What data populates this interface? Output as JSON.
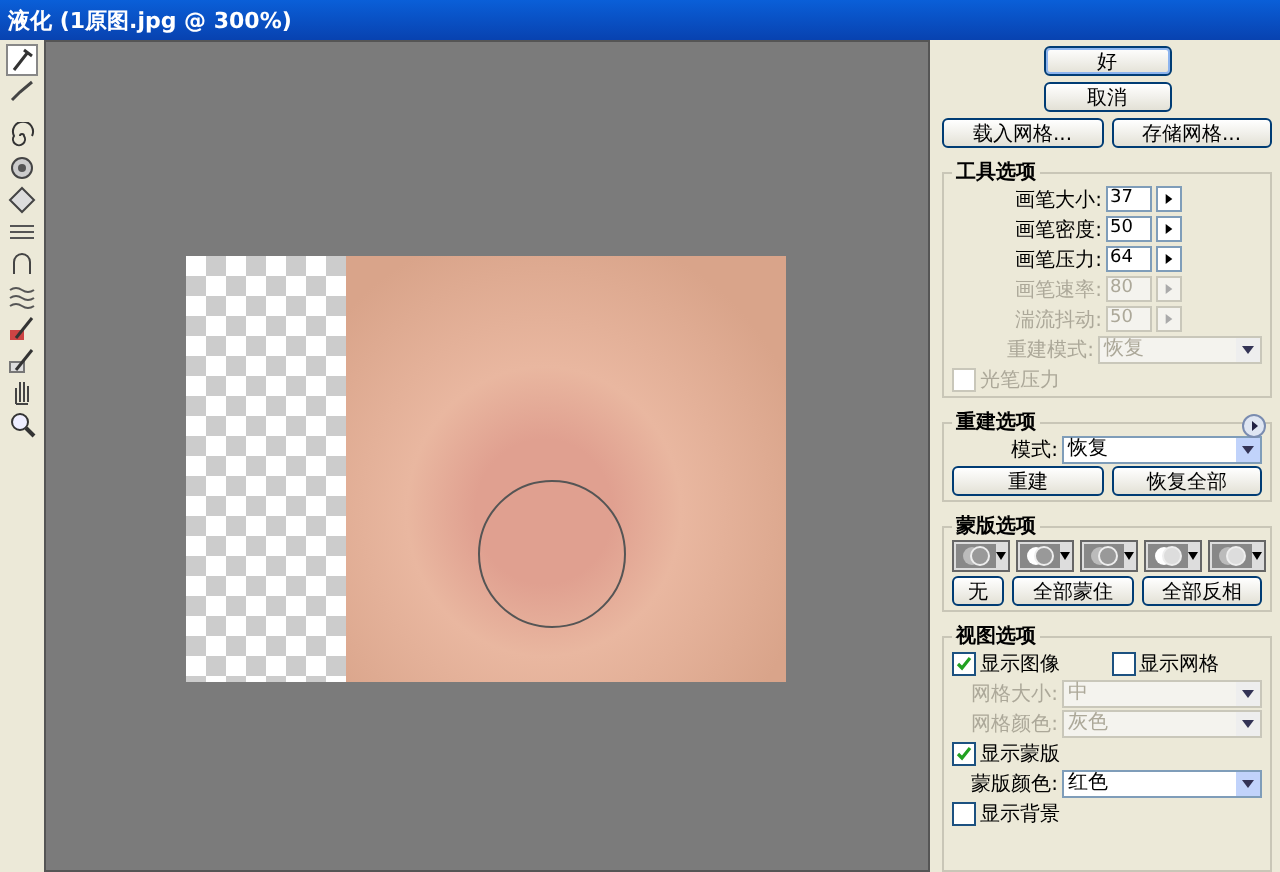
{
  "window": {
    "title": "液化 (1原图.jpg @ 300%)"
  },
  "dialog_buttons": [
    {
      "label": "好",
      "default": true
    },
    {
      "label": "取消",
      "default": false
    }
  ],
  "mesh_buttons": [
    "载入网格...",
    "存储网格..."
  ],
  "tool_options": {
    "title": "工具选项",
    "fields": [
      {
        "label": "画笔大小:",
        "value": "37",
        "disabled": false
      },
      {
        "label": "画笔密度:",
        "value": "50",
        "disabled": false
      },
      {
        "label": "画笔压力:",
        "value": "64",
        "disabled": false
      },
      {
        "label": "画笔速率:",
        "value": "80",
        "disabled": true
      },
      {
        "label": "湍流抖动:",
        "value": "50",
        "disabled": true
      }
    ],
    "rebuild_mode": {
      "label": "重建模式:",
      "value": "恢复",
      "disabled": true
    },
    "stylus_pressure": {
      "label": "光笔压力",
      "checked": false,
      "disabled": true
    }
  },
  "reconstruct_options": {
    "title": "重建选项",
    "mode": {
      "label": "模式:",
      "value": "恢复",
      "disabled": false
    },
    "buttons": [
      "重建",
      "恢复全部"
    ]
  },
  "mask_options": {
    "title": "蒙版选项",
    "buttons": [
      "无",
      "全部蒙住",
      "全部反相"
    ]
  },
  "view_options": {
    "title": "视图选项",
    "show_image": {
      "label": "显示图像",
      "checked": true
    },
    "show_mesh": {
      "label": "显示网格",
      "checked": false
    },
    "mesh_size": {
      "label": "网格大小:",
      "value": "中",
      "disabled": true
    },
    "mesh_color": {
      "label": "网格颜色:",
      "value": "灰色",
      "disabled": true
    },
    "show_mask": {
      "label": "显示蒙版",
      "checked": true
    },
    "mask_color": {
      "label": "蒙版颜色:",
      "value": "红色",
      "disabled": false
    },
    "show_backdrop": {
      "label": "显示背景",
      "checked": false
    }
  }
}
